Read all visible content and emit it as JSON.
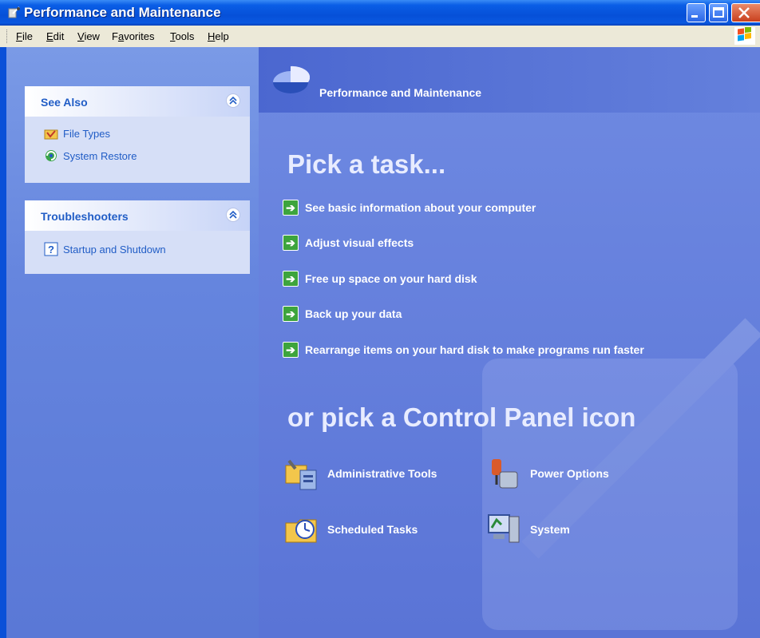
{
  "window": {
    "title": "Performance and Maintenance",
    "colors": {
      "titlebar": "#0a5ee6",
      "pane_bg": "#6585de",
      "main_bg": "#6f8ae2",
      "link": "#215dc6"
    }
  },
  "menubar": {
    "items": [
      {
        "label": "File",
        "underline": "F"
      },
      {
        "label": "Edit",
        "underline": "E"
      },
      {
        "label": "View",
        "underline": "V"
      },
      {
        "label": "Favorites",
        "underline": "a"
      },
      {
        "label": "Tools",
        "underline": "T"
      },
      {
        "label": "Help",
        "underline": "H"
      }
    ]
  },
  "sidebar": {
    "see_also": {
      "title": "See Also",
      "items": [
        {
          "label": "File Types",
          "icon": "file-types-icon"
        },
        {
          "label": "System Restore",
          "icon": "system-restore-icon"
        }
      ]
    },
    "troubleshooters": {
      "title": "Troubleshooters",
      "items": [
        {
          "label": "Startup and Shutdown",
          "icon": "help-icon"
        }
      ]
    }
  },
  "main": {
    "header_title": "Performance and Maintenance",
    "pick_task": "Pick a task...",
    "tasks": [
      {
        "label": "See basic information about your computer"
      },
      {
        "label": "Adjust visual effects"
      },
      {
        "label": "Free up space on your hard disk"
      },
      {
        "label": "Back up your data"
      },
      {
        "label": "Rearrange items on your hard disk to make programs run faster"
      }
    ],
    "pick_icon": "or pick a Control Panel icon",
    "icons": [
      {
        "label": "Administrative Tools",
        "icon": "administrative-tools-icon"
      },
      {
        "label": "Power Options",
        "icon": "power-options-icon"
      },
      {
        "label": "Scheduled Tasks",
        "icon": "scheduled-tasks-icon"
      },
      {
        "label": "System",
        "icon": "system-icon"
      }
    ]
  }
}
